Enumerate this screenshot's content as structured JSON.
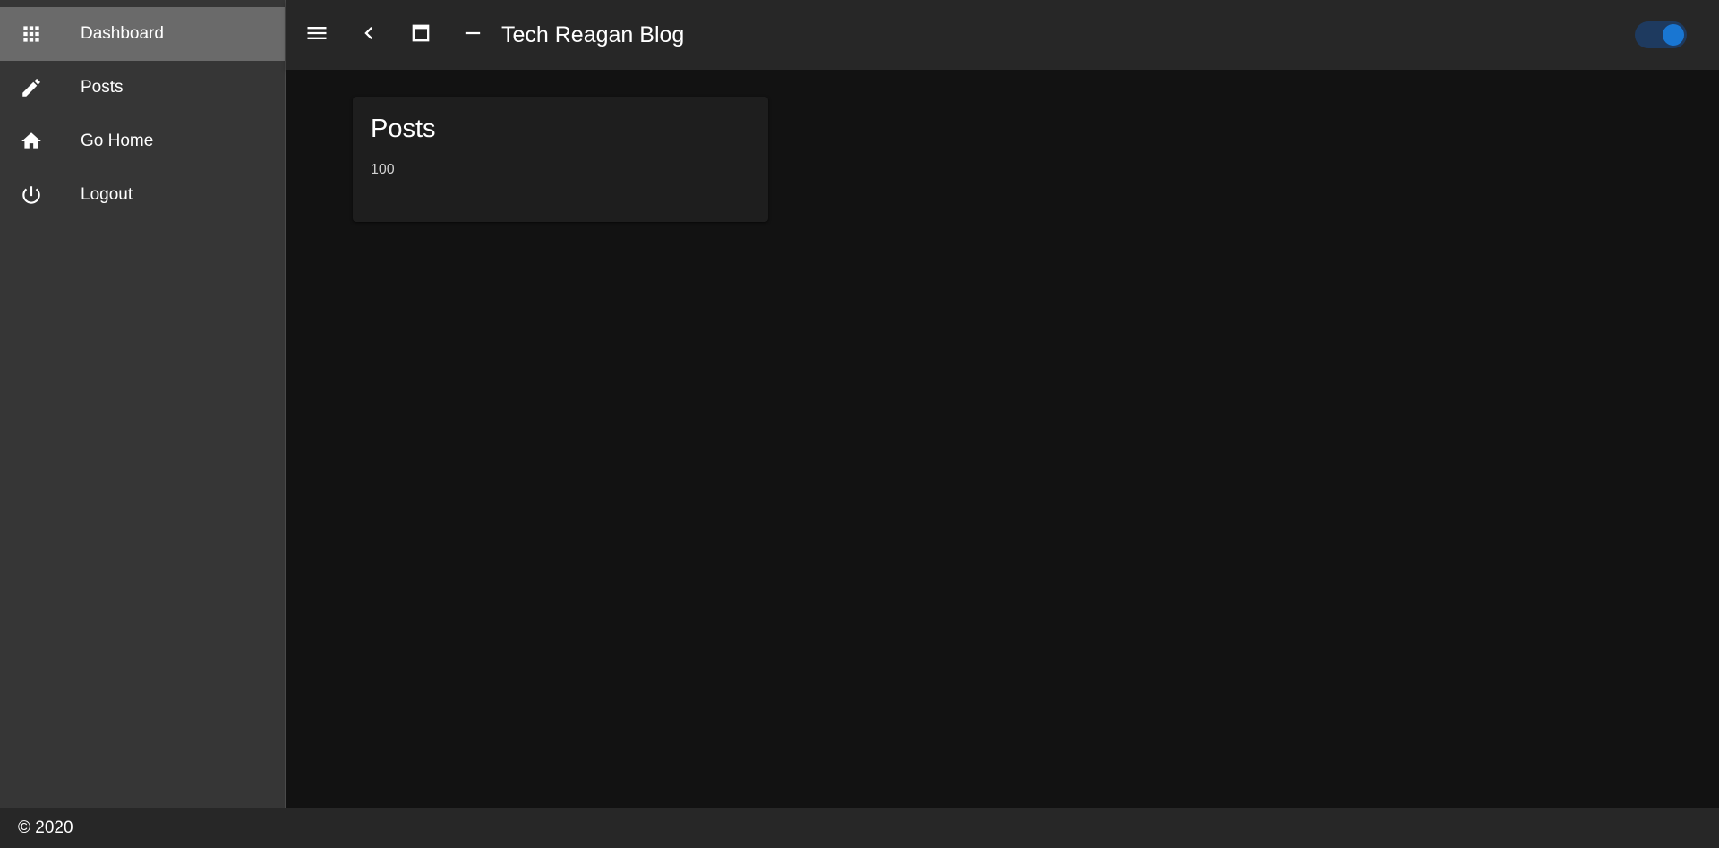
{
  "sidebar": {
    "items": [
      {
        "label": "Dashboard",
        "icon": "apps-grid-icon",
        "active": true
      },
      {
        "label": "Posts",
        "icon": "pencil-icon",
        "active": false
      },
      {
        "label": "Go Home",
        "icon": "home-icon",
        "active": false
      },
      {
        "label": "Logout",
        "icon": "power-icon",
        "active": false
      }
    ]
  },
  "header": {
    "title": "Tech Reagan Blog",
    "buttons": [
      "menu-icon",
      "chevron-left-icon",
      "window-maximize-icon",
      "minus-icon"
    ],
    "theme_toggle": {
      "on": true
    }
  },
  "main": {
    "card": {
      "title": "Posts",
      "value": "100"
    }
  },
  "footer": {
    "text": "© 2020"
  },
  "colors": {
    "sidebar_bg": "#363636",
    "sidebar_active": "#6a6a6a",
    "topbar_bg": "#272727",
    "content_bg": "#121212",
    "card_bg": "#1e1e1e",
    "toggle_track": "#1e3a5f",
    "toggle_thumb": "#1976d2"
  }
}
